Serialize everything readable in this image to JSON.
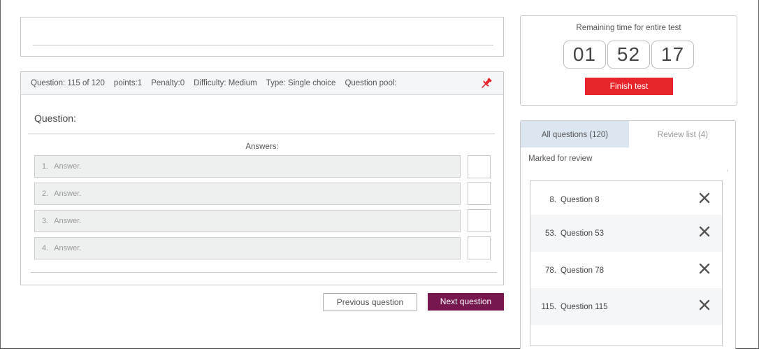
{
  "question_info": {
    "question": "Question: 115 of 120",
    "points": "points:1",
    "penalty": "Penalty:0",
    "difficulty": "Difficulty: Medium",
    "type": "Type: Single choice",
    "pool": "Question pool:"
  },
  "question_label": "Question:",
  "answers_title": "Answers:",
  "answers": [
    {
      "num": "1.",
      "text": "Answer."
    },
    {
      "num": "2.",
      "text": "Answer."
    },
    {
      "num": "3.",
      "text": "Answer."
    },
    {
      "num": "4.",
      "text": "Answer."
    }
  ],
  "nav": {
    "previous": "Previous question",
    "next": "Next question"
  },
  "timer": {
    "label": "Remaining time for entire test",
    "hours": "01",
    "minutes": "52",
    "seconds": "17",
    "finish": "Finish test"
  },
  "tabs": {
    "all": "All questions (120)",
    "review": "Review list (4)"
  },
  "marked_label": "Marked for review",
  "review_items": [
    {
      "num": "8.",
      "name": "Question 8"
    },
    {
      "num": "53.",
      "name": "Question 53"
    },
    {
      "num": "78.",
      "name": "Question 78"
    },
    {
      "num": "115.",
      "name": "Question 115"
    }
  ],
  "colors": {
    "next_button": "#77174f",
    "finish_button": "#e8242b",
    "active_tab": "#dce6f1",
    "pin": "#e8242b"
  },
  "icons": {
    "pin": "pushpin-icon",
    "remove": "close-x-icon",
    "chevron": "chevron-right-icon"
  }
}
